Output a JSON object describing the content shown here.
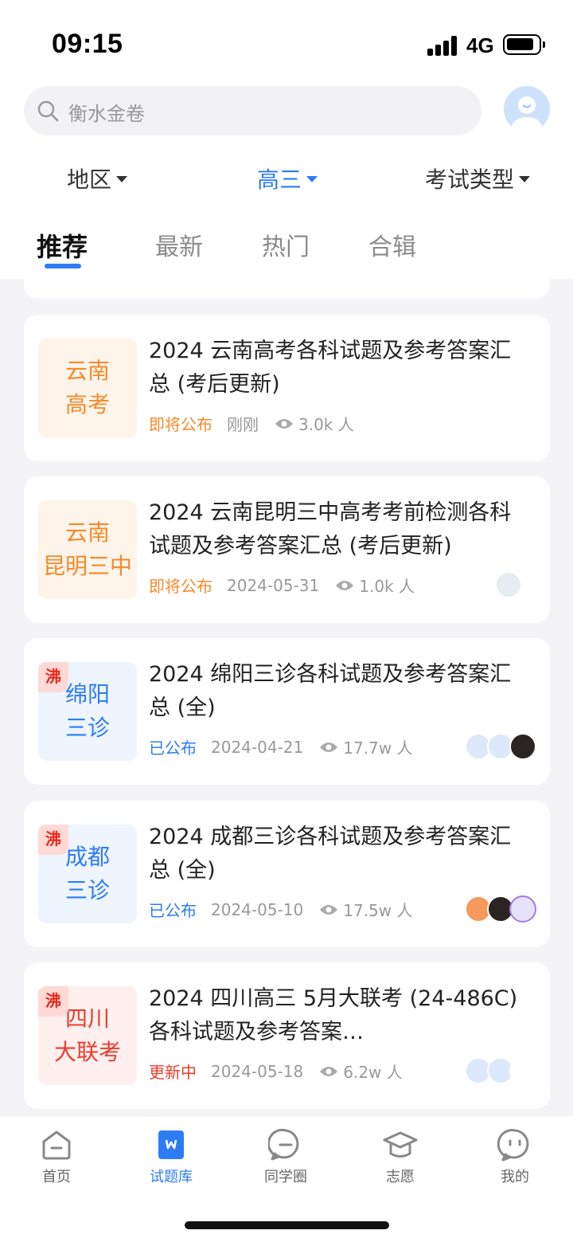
{
  "status_bar": {
    "time": "09:15",
    "network": "4G"
  },
  "search": {
    "placeholder": "衡水金卷"
  },
  "filters": [
    {
      "label": "地区",
      "active": false
    },
    {
      "label": "高三",
      "active": true
    },
    {
      "label": "考试类型",
      "active": false
    }
  ],
  "tabs": [
    {
      "label": "推荐",
      "active": true
    },
    {
      "label": "最新",
      "active": false
    },
    {
      "label": "热门",
      "active": false
    },
    {
      "label": "合辑",
      "active": false
    }
  ],
  "cards": [
    {
      "thumb_line1": "云南",
      "thumb_line2": "高考",
      "thumb_color": "#f48a2b",
      "hot": "",
      "title": "2024 云南高考各科试题及参考答案汇总 (考后更新)",
      "status": "即将公布",
      "date": "刚刚",
      "views": "3.0k 人"
    },
    {
      "thumb_line1": "云南",
      "thumb_line2": "昆明三中",
      "thumb_color": "#f48a2b",
      "hot": "",
      "title": "2024 云南昆明三中高考考前检测各科试题及参考答案汇总 (考后更新)",
      "status": "即将公布",
      "date": "2024-05-31",
      "views": "1.0k 人"
    },
    {
      "thumb_line1": "绵阳",
      "thumb_line2": "三诊",
      "thumb_color": "#2d7cf6",
      "hot": "沸",
      "title": "2024 绵阳三诊各科试题及参考答案汇总 (全)",
      "status": "已公布",
      "date": "2024-04-21",
      "views": "17.7w 人"
    },
    {
      "thumb_line1": "成都",
      "thumb_line2": "三诊",
      "thumb_color": "#2d7cf6",
      "hot": "沸",
      "title": "2024 成都三诊各科试题及参考答案汇总 (全)",
      "status": "已公布",
      "date": "2024-05-10",
      "views": "17.5w 人"
    },
    {
      "thumb_line1": "四川",
      "thumb_line2": "大联考",
      "thumb_color": "#ee3b2b",
      "hot": "沸",
      "title": "2024 四川高三 5月大联考 (24-486C) 各科试题及参考答案…",
      "status": "更新中",
      "date": "2024-05-18",
      "views": "6.2w 人"
    }
  ],
  "bottom_nav": [
    {
      "label": "首页",
      "icon": "home-icon",
      "active": false
    },
    {
      "label": "试题库",
      "icon": "question-bank-icon",
      "active": true
    },
    {
      "label": "同学圈",
      "icon": "chat-bubble-icon",
      "active": false
    },
    {
      "label": "志愿",
      "icon": "graduation-cap-icon",
      "active": false
    },
    {
      "label": "我的",
      "icon": "profile-face-icon",
      "active": false
    }
  ],
  "colors": {
    "accent": "#2d7cf6",
    "orange": "#f48a2b",
    "red": "#ee3b2b",
    "background": "#f4f4f6"
  }
}
